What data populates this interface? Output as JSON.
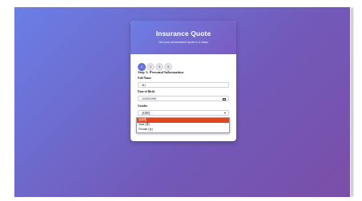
{
  "card": {
    "title": "Insurance Quote",
    "subtitle": "Get your personalized quote in 4 steps"
  },
  "steps": [
    "1",
    "2",
    "3",
    "4"
  ],
  "active_step": 1,
  "form": {
    "section_title": "Step 1: Personal Information",
    "full_name_label": "Full Name",
    "full_name_value": "lili1",
    "dob_label": "Date of Birth",
    "dob_value": "10/09/1995",
    "gender_label": "Gender",
    "gender_value": "选择性",
    "gender_options": [
      "选择性",
      "Male (男)",
      "Female (女)"
    ],
    "gender_highlighted_index": 0
  },
  "colors": {
    "accent": "#6673e0",
    "highlight": "#e0461e"
  }
}
